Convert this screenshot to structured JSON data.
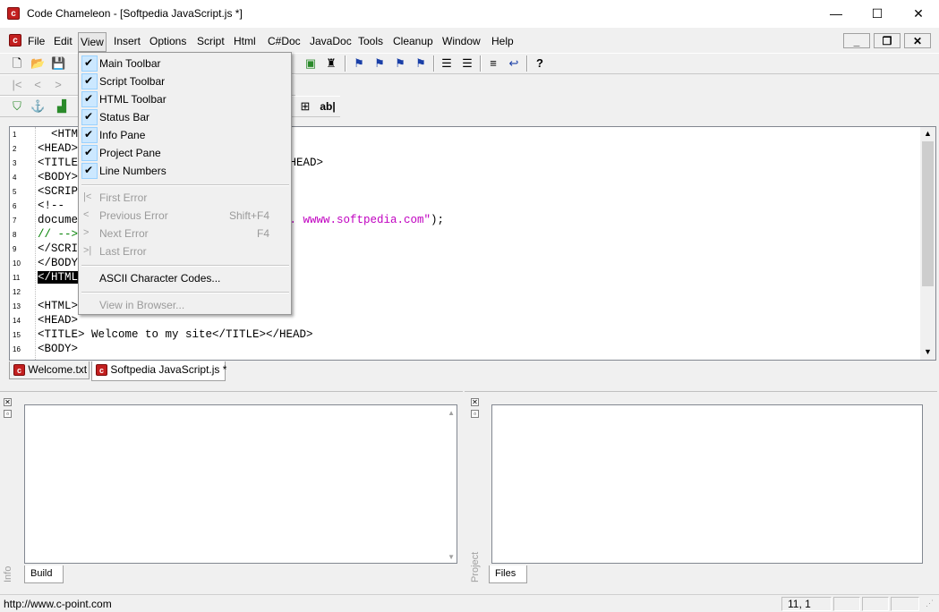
{
  "window": {
    "title": "Code Chameleon - [Softpedia JavaScript.js *]",
    "minimize": "—",
    "maximize": "☐",
    "close": "✕"
  },
  "menubar": {
    "items": [
      "File",
      "Edit",
      "View",
      "Insert",
      "Options",
      "Script",
      "Html",
      "C#Doc",
      "JavaDoc",
      "Tools",
      "Cleanup",
      "Window",
      "Help"
    ],
    "mdi_minimize": "_",
    "mdi_restore": "❐",
    "mdi_close": "✕"
  },
  "view_menu": {
    "checked_items": [
      "Main Toolbar",
      "Script Toolbar",
      "HTML Toolbar",
      "Status Bar",
      "Info Pane",
      "Project Pane",
      "Line Numbers"
    ],
    "nav_items": [
      {
        "label": "First Error",
        "shortcut": "",
        "icon": "|<"
      },
      {
        "label": "Previous Error",
        "shortcut": "Shift+F4",
        "icon": "<"
      },
      {
        "label": "Next Error",
        "shortcut": "F4",
        "icon": ">"
      },
      {
        "label": "Last Error",
        "shortcut": "",
        "icon": ">|"
      }
    ],
    "ascii": "ASCII Character Codes...",
    "browser": "View in Browser..."
  },
  "editor": {
    "line_numbers": [
      "1",
      "2",
      "3",
      "4",
      "5",
      "6",
      "7",
      "8",
      "9",
      "10",
      "11",
      "12",
      "13",
      "14",
      "15",
      "16"
    ],
    "lines": [
      {
        "text": "  <HTM",
        "color": "#000000",
        "selected": false
      },
      {
        "text": "<HEAD>",
        "color": "#000000",
        "selected": false
      },
      {
        "text": "<TITLE",
        "color": "#000000",
        "selected": false
      },
      {
        "text": "<BODY>",
        "color": "#000000",
        "selected": false
      },
      {
        "text": "<SCRIP",
        "color": "#000000",
        "selected": false
      },
      {
        "text": "<!--",
        "color": "#000000",
        "selected": false
      },
      {
        "text": "docume",
        "color": "#000000",
        "selected": false
      },
      {
        "text": "// -->",
        "color": "#008000",
        "selected": false
      },
      {
        "text": "</SCRI",
        "color": "#000000",
        "selected": false
      },
      {
        "text": "</BODY",
        "color": "#000000",
        "selected": false
      },
      {
        "text": "</HTML",
        "color": "#ffffff",
        "selected": true
      },
      {
        "text": "",
        "color": "#000000",
        "selected": false
      },
      {
        "text": "<HTML>",
        "color": "#000000",
        "selected": false
      },
      {
        "text": "<HEAD>",
        "color": "#000000",
        "selected": false
      },
      {
        "text": "<TITLE> Welcome to my site</TITLE></HEAD>",
        "color": "#000000",
        "selected": false
      },
      {
        "text": "<BODY>",
        "color": "#000000",
        "selected": false
      }
    ],
    "line3_rest": "/HEAD>",
    "line7_string": "a. wwww.softpedia.com\"",
    "line7_end": ");",
    "string_color": "#c000c0"
  },
  "file_tabs": [
    "Welcome.txt",
    "Softpedia JavaScript.js *"
  ],
  "info_pane": {
    "label": "Info",
    "tab": "Build"
  },
  "project_pane": {
    "label": "Project",
    "tab": "Files"
  },
  "statusbar": {
    "url": "http://www.c-point.com",
    "position": "11, 1"
  }
}
